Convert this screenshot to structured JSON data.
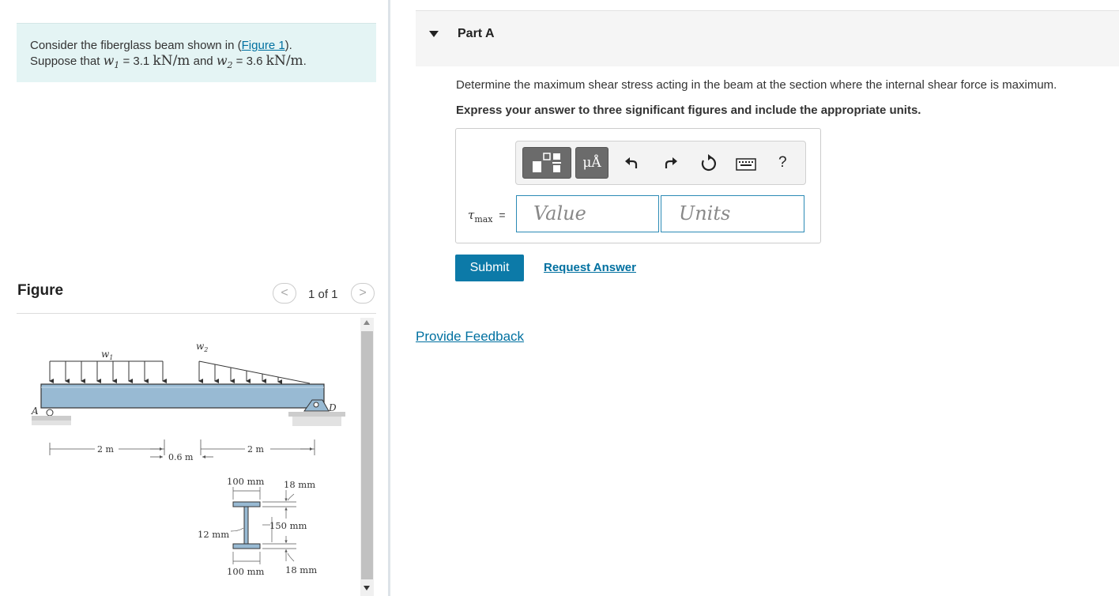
{
  "problem": {
    "line1_pre": "Consider the fiberglass beam shown in (",
    "figure_link": "Figure 1",
    "line1_post": ").",
    "line2_pre": "Suppose that ",
    "w1_var": "w",
    "w1_sub": "1",
    "w1_eq": " = 3.1 ",
    "w1_unit": "kN/m",
    "and": " and ",
    "w2_var": "w",
    "w2_sub": "2",
    "w2_eq": " = 3.6 ",
    "w2_unit": "kN/m",
    "line2_end": "."
  },
  "figure": {
    "title": "Figure",
    "pager": "1 of 1",
    "prev_glyph": "<",
    "next_glyph": ">",
    "labels": {
      "w1": "w",
      "w1_sub": "1",
      "w2": "w",
      "w2_sub": "2",
      "A": "A",
      "D": "D",
      "dim_2m_left": "2 m",
      "dim_06m": "0.6 m",
      "dim_2m_right": "2 m",
      "flange_width_top": "100 mm",
      "flange_thk_top": "18 mm",
      "web_height": "150 mm",
      "web_thk": "12 mm",
      "flange_width_bot": "100 mm",
      "flange_thk_bot": "18 mm"
    }
  },
  "part": {
    "label": "Part A",
    "question": "Determine the maximum shear stress acting in the beam at the section where the internal shear force is maximum.",
    "instruction": "Express your answer to three significant figures and include the appropriate units.",
    "toolbar": {
      "units_glyph": "μÅ",
      "help_glyph": "?"
    },
    "answer": {
      "var": "τ",
      "sub": "max",
      "eq": "=",
      "value_placeholder": "Value",
      "units_placeholder": "Units"
    },
    "submit_label": "Submit",
    "request_label": "Request Answer"
  },
  "feedback_label": "Provide Feedback",
  "colors": {
    "problem_bg": "#e4f4f4",
    "submit_bg": "#0c7aa8",
    "link": "#0070a0",
    "beam": "#98bad3",
    "input_border": "#2b8ab5"
  }
}
